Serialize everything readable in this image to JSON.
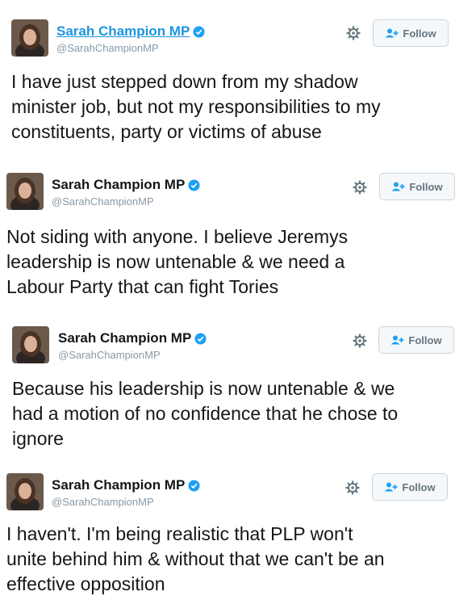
{
  "colors": {
    "verified": "#1da1f2",
    "link": "#1b95e0",
    "handle": "#8899a6",
    "follow_text": "#66757f"
  },
  "icons": {
    "settings": "gear-icon",
    "follow": "add-user-icon",
    "verified": "verified-badge-icon"
  },
  "tweets": [
    {
      "name": "Sarah Champion MP",
      "handle": "@SarahChampionMP",
      "follow_label": "Follow",
      "lines": [
        "I have just stepped down from my shadow",
        "minister job, but not my responsibilities to my",
        "constituents, party or victims of abuse"
      ]
    },
    {
      "name": "Sarah Champion MP",
      "handle": "@SarahChampionMP",
      "follow_label": "Follow",
      "lines": [
        "Not siding with anyone. I believe Jeremys",
        "leadership is now untenable & we need a",
        "Labour Party that can fight Tories"
      ]
    },
    {
      "name": "Sarah Champion MP",
      "handle": "@SarahChampionMP",
      "follow_label": "Follow",
      "lines": [
        "Because his leadership is now untenable & we",
        "had a motion of no confidence that he chose to",
        "ignore"
      ]
    },
    {
      "name": "Sarah Champion MP",
      "handle": "@SarahChampionMP",
      "follow_label": "Follow",
      "lines": [
        "I haven't. I'm being realistic that PLP won't",
        "unite behind him & without that we can't be an",
        "effective opposition"
      ]
    }
  ]
}
